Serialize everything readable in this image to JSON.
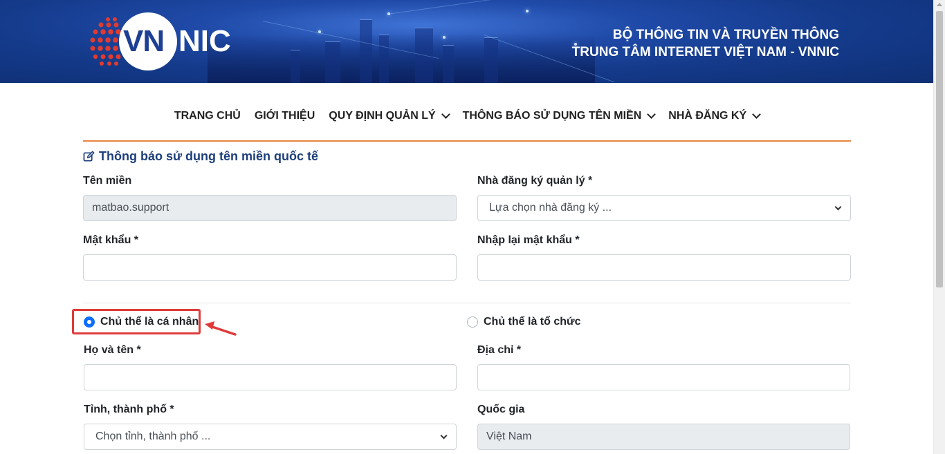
{
  "header": {
    "logo_vn": "VN",
    "logo_nic": "NIC",
    "org_line1": "BỘ THÔNG TIN VÀ TRUYỀN THÔNG",
    "org_line2": "TRUNG TÂM INTERNET VIỆT NAM - VNNIC"
  },
  "nav": {
    "items": [
      {
        "label": "TRANG CHỦ",
        "dropdown": false
      },
      {
        "label": "GIỚI THIỆU",
        "dropdown": false
      },
      {
        "label": "QUY ĐỊNH QUẢN LÝ",
        "dropdown": true
      },
      {
        "label": "THÔNG BÁO SỬ DỤNG TÊN MIỀN",
        "dropdown": true
      },
      {
        "label": "NHÀ ĐĂNG KÝ",
        "dropdown": true
      }
    ]
  },
  "form": {
    "title": "Thông báo sử dụng tên miền quốc tế",
    "domain_label": "Tên miền",
    "domain_value": "matbao.support",
    "registrar_label": "Nhà đăng ký quản lý *",
    "registrar_placeholder": "Lựa chọn nhà đăng ký ...",
    "password_label": "Mật khẩu *",
    "password_value": "",
    "password_confirm_label": "Nhập lại mật khẩu *",
    "password_confirm_value": "",
    "radio_individual": "Chủ thể là cá nhân",
    "radio_organization": "Chủ thể là tổ chức",
    "selected_subject": "individual",
    "fullname_label": "Họ và tên *",
    "fullname_value": "",
    "address_label": "Địa chỉ *",
    "address_value": "",
    "province_label": "Tỉnh, thành phố *",
    "province_placeholder": "Chọn tỉnh, thành phố ...",
    "country_label": "Quốc gia",
    "country_value": "Việt Nam"
  },
  "colors": {
    "accent_rule": "#e8863e",
    "title_blue": "#1d3f7a",
    "radio_selected": "#0d6efd",
    "highlight_red": "#e03a3a"
  }
}
